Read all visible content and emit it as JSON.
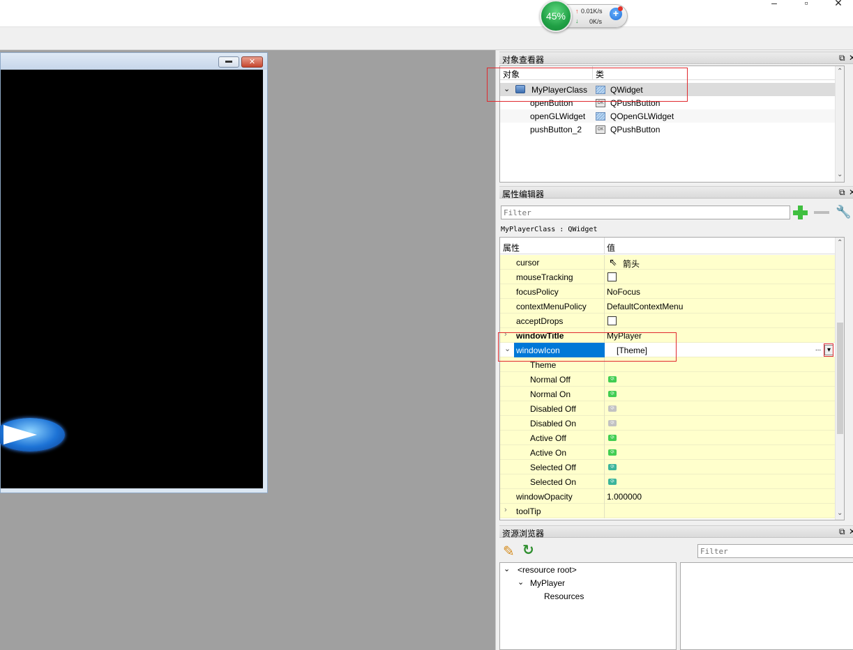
{
  "window": {
    "minimize": "–",
    "maximize": "▫",
    "close": "✕"
  },
  "net_monitor": {
    "percent": "45%",
    "upload": "0.01K/s",
    "download": "0K/s",
    "up_arrow": "↑",
    "down_arrow": "↓",
    "plus": "+"
  },
  "object_inspector": {
    "title": "对象查看器",
    "col_object": "对象",
    "col_class": "类",
    "rows": [
      {
        "name": "MyPlayerClass",
        "class": "QWidget",
        "expanded": true,
        "selected": true
      },
      {
        "name": "openButton",
        "class": "QPushButton"
      },
      {
        "name": "openGLWidget",
        "class": "QOpenGLWidget"
      },
      {
        "name": "pushButton_2",
        "class": "QPushButton"
      }
    ]
  },
  "property_editor": {
    "title": "属性编辑器",
    "filter_placeholder": "Filter",
    "context": "MyPlayerClass : QWidget",
    "col_property": "属性",
    "col_value": "值",
    "rows": [
      {
        "name": "cursor",
        "value": "箭头"
      },
      {
        "name": "mouseTracking",
        "value": ""
      },
      {
        "name": "focusPolicy",
        "value": "NoFocus"
      },
      {
        "name": "contextMenuPolicy",
        "value": "DefaultContextMenu"
      },
      {
        "name": "acceptDrops",
        "value": ""
      },
      {
        "name": "windowTitle",
        "value": "MyPlayer"
      },
      {
        "name": "windowIcon",
        "value": "[Theme]"
      },
      {
        "name": "Theme",
        "value": ""
      },
      {
        "name": "Normal Off",
        "value": ""
      },
      {
        "name": "Normal On",
        "value": ""
      },
      {
        "name": "Disabled Off",
        "value": ""
      },
      {
        "name": "Disabled On",
        "value": ""
      },
      {
        "name": "Active Off",
        "value": ""
      },
      {
        "name": "Active On",
        "value": ""
      },
      {
        "name": "Selected Off",
        "value": ""
      },
      {
        "name": "Selected On",
        "value": ""
      },
      {
        "name": "windowOpacity",
        "value": "1.000000"
      },
      {
        "name": "toolTip",
        "value": ""
      }
    ],
    "ellipsis": "...",
    "dropdown": "▾"
  },
  "resource_browser": {
    "title": "资源浏览器",
    "filter_placeholder": "Filter",
    "tree": [
      {
        "label": "<resource root>"
      },
      {
        "label": "MyPlayer"
      },
      {
        "label": "Resources"
      }
    ]
  },
  "colors": {
    "selection": "#0078d7",
    "property_bg": "#ffffcc",
    "highlight_box": "#e0282d"
  },
  "icons": [
    "float-icon",
    "close-icon",
    "plus-icon",
    "minus-icon",
    "wrench-icon",
    "pencil-icon",
    "refresh-icon",
    "qt-icon",
    "widget-icon",
    "pushbutton-icon",
    "arrow-cursor-icon"
  ]
}
